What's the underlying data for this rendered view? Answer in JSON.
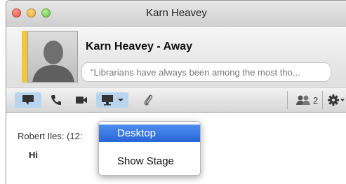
{
  "window": {
    "title": "Karn Heavey"
  },
  "contact": {
    "name_status": "Karn Heavey - Away",
    "status_message": "\"Librarians have always been among the most tho...",
    "status_color": "#f2c542"
  },
  "toolbar": {
    "participants_count": "2",
    "items": [
      {
        "icon": "chat-bubble-icon",
        "active": true
      },
      {
        "icon": "phone-icon"
      },
      {
        "icon": "video-camera-icon"
      },
      {
        "icon": "screen-share-icon",
        "active": true,
        "has_dropdown": true
      },
      {
        "icon": "paperclip-icon"
      },
      {
        "icon": "participants-icon"
      },
      {
        "icon": "gear-icon",
        "has_dropdown": true
      }
    ]
  },
  "chat": {
    "sender": "Robert Iles: (12:",
    "message": "Hi"
  },
  "share_menu": {
    "items": [
      {
        "label": "Desktop",
        "selected": true
      },
      {
        "label": "Show Stage"
      }
    ]
  },
  "colors": {
    "menu_highlight": "#2f6fe0",
    "toolbar_active": "#b9d4ef"
  }
}
